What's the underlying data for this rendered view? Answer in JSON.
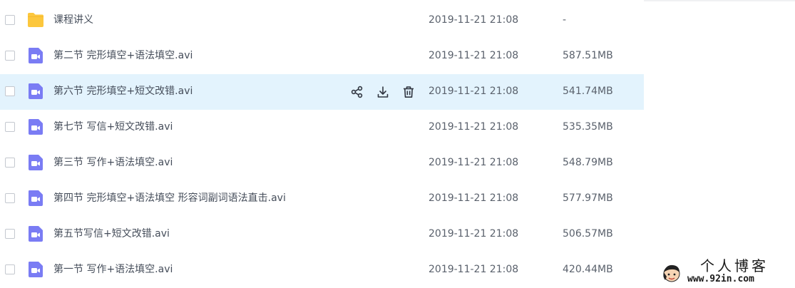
{
  "colors": {
    "hover_row_bg": "#e3f3fd",
    "folder_icon": "#fcc73d",
    "video_icon": "#7a7cf4",
    "text_primary": "#454d5a",
    "text_secondary": "#5a616c"
  },
  "files": [
    {
      "icon": "folder-icon",
      "name": "课程讲义",
      "date": "2019-11-21 21:08",
      "size": "-"
    },
    {
      "icon": "video-file-icon",
      "name": "第二节 完形填空+语法填空.avi",
      "date": "2019-11-21 21:08",
      "size": "587.51MB"
    },
    {
      "icon": "video-file-icon",
      "name": "第六节 完形填空+短文改错.avi",
      "date": "2019-11-21 21:08",
      "size": "541.74MB",
      "hovered": true,
      "actions": [
        {
          "name": "share-icon",
          "label": "share"
        },
        {
          "name": "download-icon",
          "label": "download"
        },
        {
          "name": "delete-icon",
          "label": "delete"
        }
      ]
    },
    {
      "icon": "video-file-icon",
      "name": "第七节 写信+短文改错.avi",
      "date": "2019-11-21 21:08",
      "size": "535.35MB"
    },
    {
      "icon": "video-file-icon",
      "name": "第三节 写作+语法填空.avi",
      "date": "2019-11-21 21:08",
      "size": "548.79MB"
    },
    {
      "icon": "video-file-icon",
      "name": "第四节 完形填空+语法填空 形容词副词语法直击.avi",
      "date": "2019-11-21 21:08",
      "size": "577.97MB"
    },
    {
      "icon": "video-file-icon",
      "name": "第五节写信+短文改错.avi",
      "date": "2019-11-21 21:08",
      "size": "506.57MB"
    },
    {
      "icon": "video-file-icon",
      "name": "第一节 写作+语法填空.avi",
      "date": "2019-11-21 21:08",
      "size": "420.44MB"
    }
  ],
  "watermark": {
    "title": "个人博客",
    "url": "www.92in.com"
  }
}
